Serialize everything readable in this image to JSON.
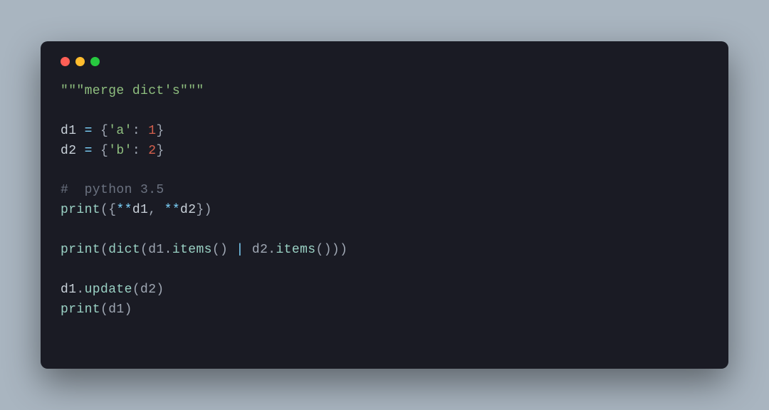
{
  "colors": {
    "background": "#a9b5c0",
    "window_bg": "#1a1b24",
    "traffic_red": "#ff5f56",
    "traffic_yellow": "#ffbd2e",
    "traffic_green": "#27c93f",
    "string": "#8fbf7f",
    "number": "#d6604d",
    "comment": "#6b7280",
    "operator": "#7dd3fc",
    "punct": "#a0a8b4",
    "builtin": "#9ad1c4",
    "identifier": "#c9d1d9"
  },
  "code": {
    "language": "python",
    "tokens": [
      [
        {
          "t": "\"\"\"merge dict's\"\"\"",
          "c": "str"
        }
      ],
      [],
      [
        {
          "t": "d1 ",
          "c": "id"
        },
        {
          "t": "=",
          "c": "op"
        },
        {
          "t": " {",
          "c": "punc"
        },
        {
          "t": "'a'",
          "c": "str"
        },
        {
          "t": ": ",
          "c": "punc"
        },
        {
          "t": "1",
          "c": "num"
        },
        {
          "t": "}",
          "c": "punc"
        }
      ],
      [
        {
          "t": "d2 ",
          "c": "id"
        },
        {
          "t": "=",
          "c": "op"
        },
        {
          "t": " {",
          "c": "punc"
        },
        {
          "t": "'b'",
          "c": "str"
        },
        {
          "t": ": ",
          "c": "punc"
        },
        {
          "t": "2",
          "c": "num"
        },
        {
          "t": "}",
          "c": "punc"
        }
      ],
      [],
      [
        {
          "t": "#  python 3.5",
          "c": "cmt"
        }
      ],
      [
        {
          "t": "print",
          "c": "fn"
        },
        {
          "t": "({",
          "c": "punc"
        },
        {
          "t": "**",
          "c": "op"
        },
        {
          "t": "d1",
          "c": "id"
        },
        {
          "t": ", ",
          "c": "punc"
        },
        {
          "t": "**",
          "c": "op"
        },
        {
          "t": "d2",
          "c": "id"
        },
        {
          "t": "})",
          "c": "punc"
        }
      ],
      [],
      [
        {
          "t": "print",
          "c": "fn"
        },
        {
          "t": "(",
          "c": "punc"
        },
        {
          "t": "dict",
          "c": "fn"
        },
        {
          "t": "(d1",
          "c": "punc"
        },
        {
          "t": ".",
          "c": "punc"
        },
        {
          "t": "items",
          "c": "fn"
        },
        {
          "t": "() ",
          "c": "punc"
        },
        {
          "t": "|",
          "c": "op"
        },
        {
          "t": " d2",
          "c": "punc"
        },
        {
          "t": ".",
          "c": "punc"
        },
        {
          "t": "items",
          "c": "fn"
        },
        {
          "t": "()))",
          "c": "punc"
        }
      ],
      [],
      [
        {
          "t": "d1",
          "c": "id"
        },
        {
          "t": ".",
          "c": "punc"
        },
        {
          "t": "update",
          "c": "fn"
        },
        {
          "t": "(d2)",
          "c": "punc"
        }
      ],
      [
        {
          "t": "print",
          "c": "fn"
        },
        {
          "t": "(d1)",
          "c": "punc"
        }
      ]
    ]
  }
}
